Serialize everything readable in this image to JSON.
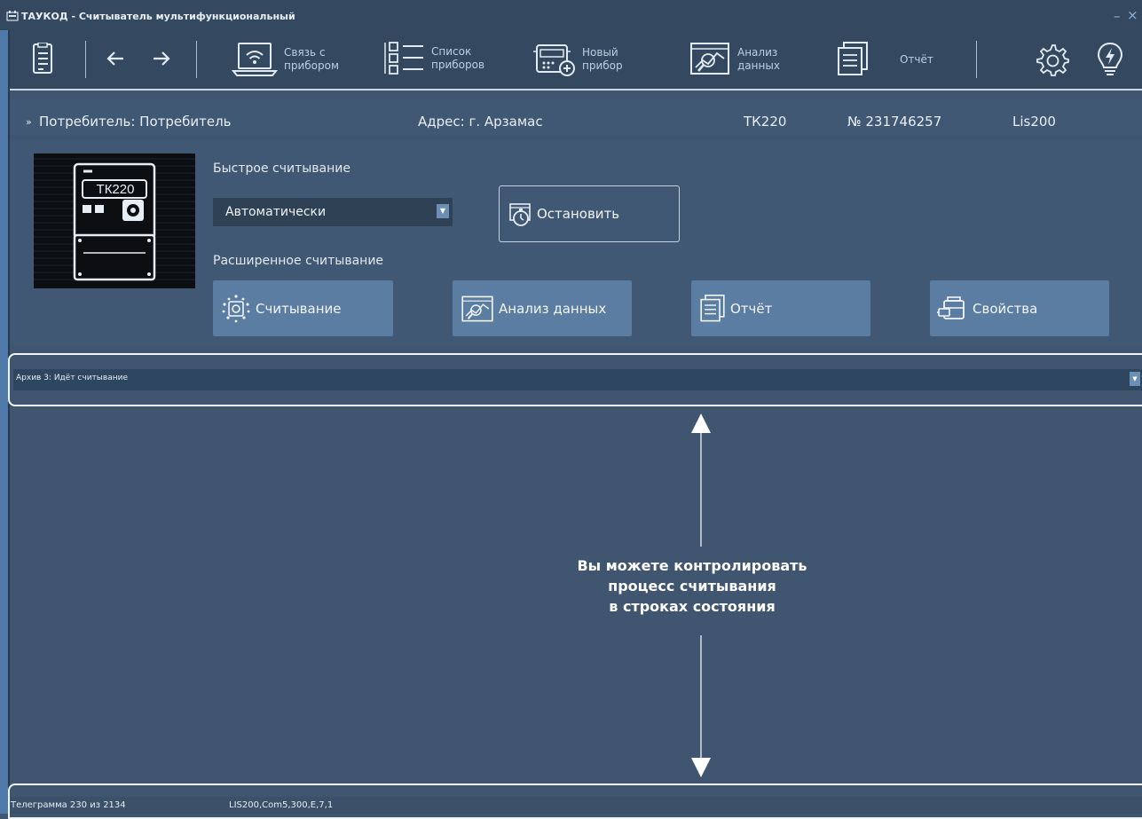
{
  "window": {
    "title": "ТАУКОД - Считыватель мультифункциональный",
    "minimize_glyph": "–",
    "close_glyph": "×"
  },
  "toolbar": {
    "items": [
      {
        "icon": "document-list-icon",
        "label": ""
      },
      {
        "icon": "arrow-left-icon",
        "label": ""
      },
      {
        "icon": "arrow-right-icon",
        "label": ""
      },
      {
        "icon": "laptop-wifi-icon",
        "label": "Связь с\nприбором"
      },
      {
        "icon": "checklist-icon",
        "label": "Список\nприборов"
      },
      {
        "icon": "new-device-icon",
        "label": "Новый\nприбор"
      },
      {
        "icon": "data-analysis-icon",
        "label": "Анализ\nданных"
      },
      {
        "icon": "report-icon",
        "label": "Отчёт"
      },
      {
        "icon": "gear-icon",
        "label": ""
      },
      {
        "icon": "lightbulb-icon",
        "label": ""
      }
    ]
  },
  "info_bar": {
    "collapse_glyph": "»",
    "consumer": "Потребитель: Потребитель",
    "address": "Адрес: г. Арзамас",
    "device_model": "ТК220",
    "serial": "№ 231746257",
    "corrector": "Lis200"
  },
  "device": {
    "screen_label": "ТК220"
  },
  "quick_read": {
    "label": "Быстрое считывание",
    "mode_value": "Автоматически",
    "stop_button": "Остановить"
  },
  "extended_read": {
    "label": "Расширенное считывание",
    "buttons": [
      {
        "icon": "reading-icon",
        "label": "Считывание"
      },
      {
        "icon": "data-analysis-icon",
        "label": "Анализ данных"
      },
      {
        "icon": "report-icon",
        "label": "Отчёт"
      },
      {
        "icon": "properties-icon",
        "label": "Свойства"
      }
    ]
  },
  "status_line": {
    "text": "Архив 3: Идёт считывание"
  },
  "annotation": {
    "line1": "Вы можете контролировать",
    "line2": "процесс считывания",
    "line3": "в строках состояния"
  },
  "bottom_status": {
    "telegram": "Телеграмма 230 из 2134",
    "connection": "LIS200,Com5,300,E,7,1"
  },
  "colors": {
    "background": "#3f5570",
    "toolbar": "#34495f",
    "action_button": "#5b7da2",
    "accent": "#4f79a8",
    "highlight_border": "#f1f4f7"
  }
}
